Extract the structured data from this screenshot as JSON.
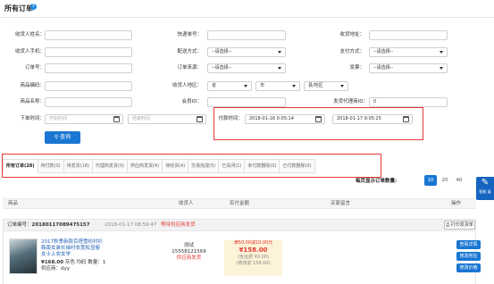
{
  "page": {
    "title": "所有订单",
    "help_icon": "question-circle-icon"
  },
  "filters": {
    "receiver_name_label": "收货人姓名：",
    "receiver_phone_label": "收货人手机：",
    "order_no_label": "订单号：",
    "product_code_label": "商品编码：",
    "product_name_label": "商品名称：",
    "order_time_label": "下单时间：",
    "order_time_start_placeholder": "开始时间",
    "order_time_end_placeholder": "结束时间",
    "tracking_no_label": "快递单号：",
    "delivery_method_label": "配送方式：",
    "delivery_method_value": "--请选择--",
    "order_source_label": "订单来源：",
    "order_source_value": "--请选择--",
    "receiver_region_label": "收货人地区：",
    "province_value": "省",
    "city_value": "市",
    "county_value": "县/地区",
    "member_id_label": "会员ID：",
    "payment_time_label": "付款时间：",
    "payment_time_start": "2018-01-16 0:05:14",
    "payment_time_end": "2018-01-17 9:05:25",
    "receiver_address_label": "收货地址：",
    "payment_method_label": "支付方式：",
    "payment_method_value": "--请选择--",
    "invoice_label": "发票：",
    "invoice_value": "--请选择--",
    "distributor_id_label": "发货代理商ID：",
    "distributor_id_value": "0",
    "search_label": "查询"
  },
  "tabs": [
    {
      "label": "所有订单(28)",
      "active": true
    },
    {
      "label": "待付款(0)"
    },
    {
      "label": "待发货(18)"
    },
    {
      "label": "代理商发货(0)"
    },
    {
      "label": "供应商发货(4)"
    },
    {
      "label": "待收货(4)"
    },
    {
      "label": "交易完成(5)"
    },
    {
      "label": "已关闭(1)"
    },
    {
      "label": "未付款删除(0)"
    },
    {
      "label": "已付款删除(0)"
    }
  ],
  "pagination": {
    "label": "每页显示订单数量:",
    "options": [
      "10",
      "20",
      "40"
    ],
    "active": "10"
  },
  "float_button": {
    "icon": "edit-icon",
    "label": "智能 展"
  },
  "table_headers": {
    "product": "商品",
    "buyer": "收货人",
    "amount": "实付金额",
    "message": "买家留言",
    "actions": "操作"
  },
  "order": {
    "number_prefix": "订单编号：",
    "number": "20180117089475157",
    "time": "2018-01-17 08:59:47",
    "status": "等待供应商发货",
    "print_label": "打印发货单",
    "product_title": "2017秋季新款百搭雪纺衬衫韩版女装长袖衬衣宽松显瘦女士上衣女学",
    "price": "¥168.00",
    "variant": "灰色 均码",
    "quantity_text": "数量：1",
    "supplier": "供应商：dyy",
    "buyer_name": "测试",
    "buyer_phone": "15558121569",
    "shipping_status": "供应商发货",
    "discount_text": "满50.00减10.00元",
    "total": "¥158.00",
    "freight_text": "(含运费 ¥0.00)",
    "original_text": "(修改前 158.00)",
    "actions": [
      "查看详情",
      "修改地址",
      "修改价格"
    ]
  },
  "colors": {
    "accent": "#1976d2",
    "danger": "#e53935",
    "highlight": "#fdf3d8"
  }
}
